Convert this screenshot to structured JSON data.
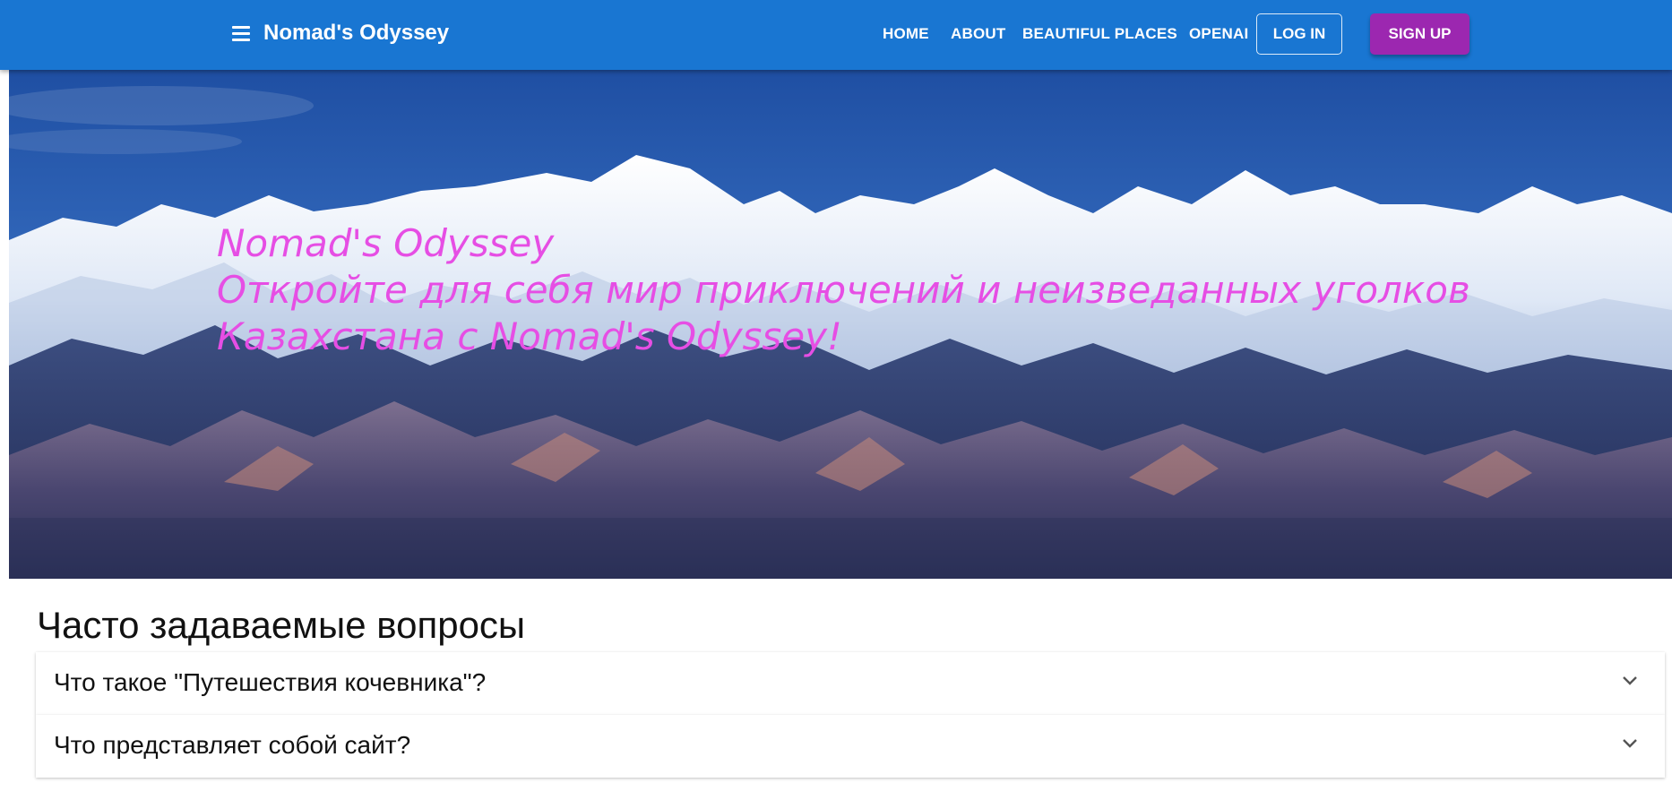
{
  "header": {
    "brand": "Nomad's Odyssey",
    "nav": [
      "HOME",
      "ABOUT",
      "BEAUTIFUL PLACES",
      "OPENAI"
    ],
    "login_label": "LOG IN",
    "signup_label": "SIGN UP",
    "bar_color": "#1976d2",
    "signup_color": "#9c27b0"
  },
  "hero": {
    "line1": "Nomad's Odyssey",
    "line2": "Откройте для себя мир приключений и неизведанных уголков",
    "line3": "Казахстана с Nomad's Odyssey!",
    "text_color": "#e64ee4"
  },
  "faq": {
    "title": "Часто задаваемые вопросы",
    "items": [
      {
        "question": "Что такое \"Путешествия кочевника\"?"
      },
      {
        "question": "Что представляет собой сайт?"
      }
    ]
  }
}
